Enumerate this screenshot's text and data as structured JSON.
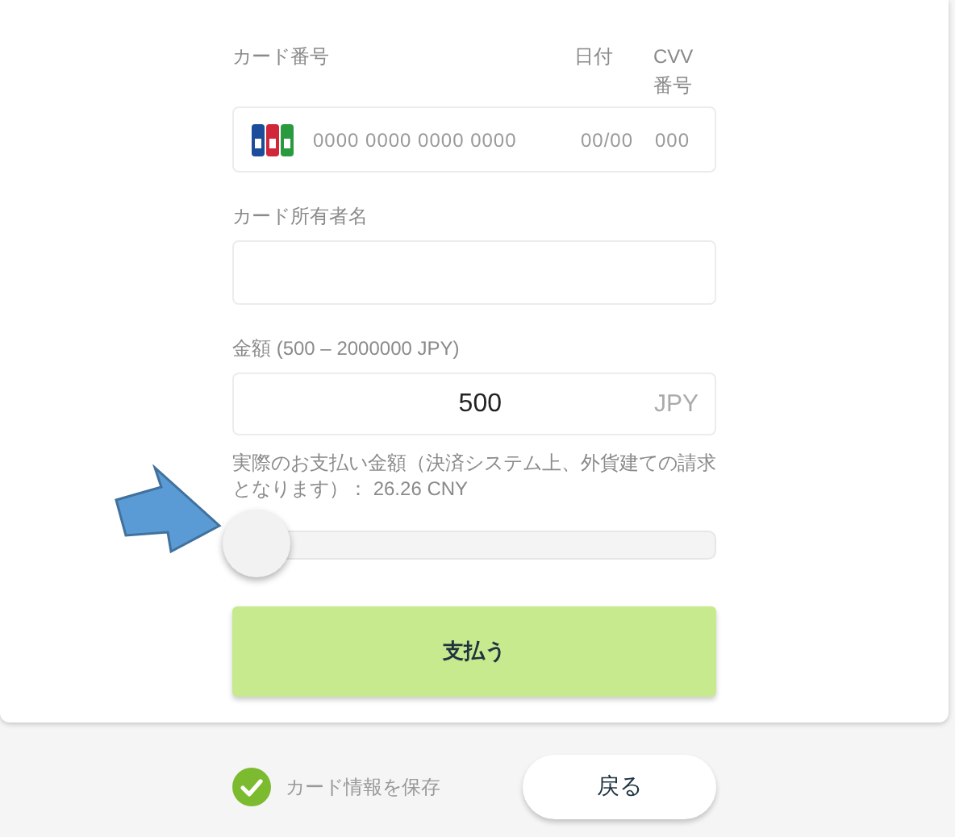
{
  "card_number": {
    "label": "カード番号",
    "placeholder": "0000 0000 0000 0000"
  },
  "expiry": {
    "label": "日付",
    "placeholder": "00/00"
  },
  "cvv": {
    "label": "CVV番号",
    "placeholder": "000"
  },
  "holder": {
    "label": "カード所有者名"
  },
  "amount": {
    "label": "金額 (500 – 2000000 JPY)",
    "value": "500",
    "currency": "JPY"
  },
  "actual_amount": "実際のお支払い金額（決済システム上、外貨建ての請求となります）： 26.26 CNY",
  "slider": {
    "level": 0
  },
  "pay_button": "支払う",
  "save_card": {
    "label": "カード情報を保存",
    "checked": true
  },
  "back_button": "戻る"
}
